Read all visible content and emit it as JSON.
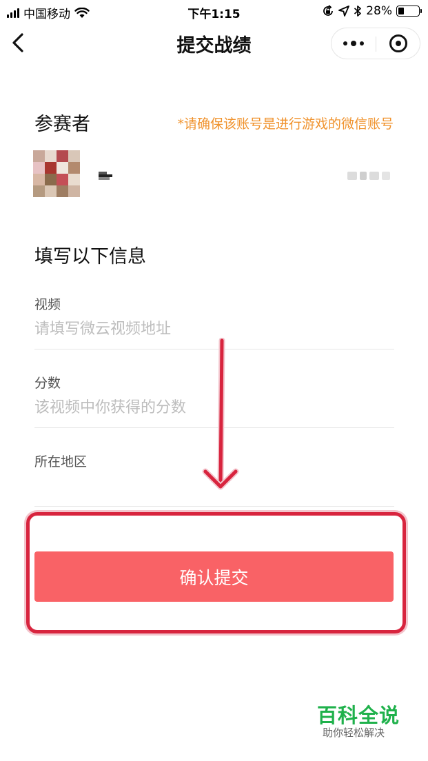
{
  "status_bar": {
    "carrier": "中国移动",
    "time": "下午1:15",
    "battery_text": "28%",
    "battery_level": 0.28
  },
  "nav": {
    "title": "提交战绩"
  },
  "participant": {
    "section_title": "参赛者",
    "notice": "*请确保该账号是进行游戏的微信账号"
  },
  "form": {
    "section_title": "填写以下信息",
    "fields": [
      {
        "label": "视频",
        "placeholder": "请填写微云视频地址",
        "value": ""
      },
      {
        "label": "分数",
        "placeholder": "该视频中你获得的分数",
        "value": ""
      },
      {
        "label": "所在地区",
        "placeholder": "",
        "value": ""
      }
    ]
  },
  "submit": {
    "label": "确认提交"
  },
  "watermark": {
    "title": "百科全说",
    "subtitle": "助你轻松解决"
  },
  "colors": {
    "accent_orange": "#f0922c",
    "button_red": "#f96266",
    "annotation_red": "#d8243e",
    "watermark_green": "#1fb14b"
  },
  "icons": {
    "back": "chevron-left-icon",
    "more": "more-dots-icon",
    "close": "target-circle-icon",
    "wifi": "wifi-icon",
    "location": "location-arrow-icon",
    "bluetooth": "bluetooth-icon",
    "orientation_lock": "orientation-lock-icon"
  }
}
